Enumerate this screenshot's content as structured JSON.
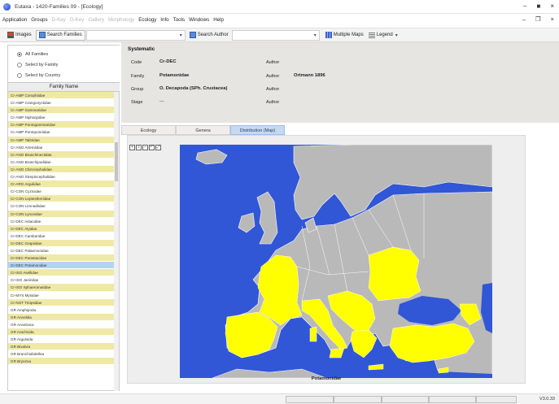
{
  "window": {
    "title": "Eutaxa - 1420-Families 09 - [Ecology]",
    "controls": [
      "–",
      "■",
      "×"
    ],
    "menu_controls": [
      "–",
      "❐",
      "×"
    ]
  },
  "menu": {
    "items": [
      {
        "label": "Application",
        "disabled": false
      },
      {
        "label": "Groups",
        "disabled": false
      },
      {
        "label": "D-Key",
        "disabled": true
      },
      {
        "label": "G-Key",
        "disabled": true
      },
      {
        "label": "Gallery",
        "disabled": true
      },
      {
        "label": "Morphology",
        "disabled": true
      },
      {
        "label": "Ecology",
        "disabled": false
      },
      {
        "label": "Info",
        "disabled": false
      },
      {
        "label": "Tools",
        "disabled": false
      },
      {
        "label": "Windows",
        "disabled": false
      },
      {
        "label": "Help",
        "disabled": false
      }
    ]
  },
  "toolbar": {
    "images_label": "Images",
    "search_families_label": "Search Families",
    "search_author_label": "Search Author",
    "multiple_maps_label": "Multiple Maps",
    "legend_label": "Legend"
  },
  "sidebar": {
    "filters": [
      {
        "label": "All Families",
        "checked": true
      },
      {
        "label": "Select by Family",
        "checked": false
      },
      {
        "label": "Select by Country",
        "checked": false
      }
    ],
    "list_header": "Family Name",
    "items": [
      {
        "label": "Cr-AMP Corophiidae",
        "hl": true,
        "sel": false
      },
      {
        "label": "Cr-AMP Crangonyctidae",
        "hl": false,
        "sel": false
      },
      {
        "label": "Cr-AMP Gammaridae",
        "hl": true,
        "sel": false
      },
      {
        "label": "Cr-AMP Niphargidae",
        "hl": false,
        "sel": false
      },
      {
        "label": "Cr-AMP Pontogammaridae",
        "hl": true,
        "sel": false
      },
      {
        "label": "Cr-AMP Pontoporeiidae",
        "hl": false,
        "sel": false
      },
      {
        "label": "Cr-AMP Talitridae",
        "hl": true,
        "sel": false
      },
      {
        "label": "Cr-ANO Artemiidae",
        "hl": false,
        "sel": false
      },
      {
        "label": "Cr-ANO Branchinectidae",
        "hl": true,
        "sel": false
      },
      {
        "label": "Cr-ANO Branchipodidae",
        "hl": false,
        "sel": false
      },
      {
        "label": "Cr-ANO Chirocephalidae",
        "hl": true,
        "sel": false
      },
      {
        "label": "Cr-ANO Streptocephalidae",
        "hl": false,
        "sel": false
      },
      {
        "label": "Cr-ARG Argulidae",
        "hl": true,
        "sel": false
      },
      {
        "label": "Cr-CON Cyzicidae",
        "hl": false,
        "sel": false
      },
      {
        "label": "Cr-CON Leptestheriidae",
        "hl": true,
        "sel": false
      },
      {
        "label": "Cr-CON Limnadiidae",
        "hl": false,
        "sel": false
      },
      {
        "label": "Cr-CON Lynceidae",
        "hl": true,
        "sel": false
      },
      {
        "label": "Cr-DEC Astacidae",
        "hl": false,
        "sel": false
      },
      {
        "label": "Cr-DEC Atyidae",
        "hl": true,
        "sel": false
      },
      {
        "label": "Cr-DEC Cambaridae",
        "hl": false,
        "sel": false
      },
      {
        "label": "Cr-DEC Grapsidae",
        "hl": true,
        "sel": false
      },
      {
        "label": "Cr-DEC Palaemonidae",
        "hl": false,
        "sel": false
      },
      {
        "label": "Cr-DEC Parastacidae",
        "hl": true,
        "sel": false
      },
      {
        "label": "Cr-DEC Potamonidae",
        "hl": false,
        "sel": true
      },
      {
        "label": "Cr-ISO Asellidae",
        "hl": true,
        "sel": false
      },
      {
        "label": "Cr-ISO Janiridae",
        "hl": false,
        "sel": false
      },
      {
        "label": "Cr-ISO Sphaeromatidae",
        "hl": true,
        "sel": false
      },
      {
        "label": "Cr-MYS Mysidae",
        "hl": false,
        "sel": false
      },
      {
        "label": "Cr-NOT Triopsidae",
        "hl": true,
        "sel": false
      },
      {
        "label": "GR Amphipoda",
        "hl": false,
        "sel": false
      },
      {
        "label": "GR Annelida",
        "hl": true,
        "sel": false
      },
      {
        "label": "GR Anostraca",
        "hl": false,
        "sel": false
      },
      {
        "label": "GR Arachnida",
        "hl": true,
        "sel": false
      },
      {
        "label": "GR Arguloida",
        "hl": false,
        "sel": false
      },
      {
        "label": "GR Bivalvia",
        "hl": true,
        "sel": false
      },
      {
        "label": "GR Branchiobdellea",
        "hl": false,
        "sel": false
      },
      {
        "label": "GR Bryozoa",
        "hl": true,
        "sel": false
      }
    ]
  },
  "detail": {
    "title": "Systematic",
    "code_label": "Code",
    "code_value": "Cr-DEC",
    "family_label": "Family",
    "family_value": "Potamonidae",
    "group_label": "Group",
    "group_value": "O. Decapoda (SPh. Crustacea)",
    "stage_label": "Stage",
    "stage_value": "---",
    "author_label_1": "Author",
    "author_label_2": "Author",
    "author_value_2": "Ortmann 1896",
    "author_label_3": "Author",
    "author_label_4": "Author"
  },
  "tabs": [
    {
      "label": "Ecology",
      "active": false
    },
    {
      "label": "Genera",
      "active": false
    },
    {
      "label": "Distribution (Map)",
      "active": true
    }
  ],
  "map": {
    "caption": "Potamonidae",
    "tools": [
      "+",
      "⌕",
      "–",
      "↶",
      "⤢"
    ],
    "colors": {
      "sea": "#3157d6",
      "land": "#b9b9b9",
      "distribution": "#ffff00",
      "border": "#ffffff"
    }
  },
  "status": {
    "version": "V3.0.33"
  }
}
